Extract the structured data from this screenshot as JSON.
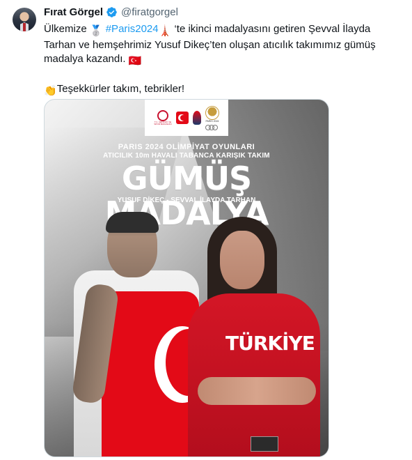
{
  "tweet": {
    "author_name": "Fırat Görgel",
    "handle": "@firatgorgel",
    "text_line1_before_emoji": "Ülkemize ",
    "medal_emoji": "🥈",
    "hashtag": "#Paris2024",
    "tower_emoji": "🗼",
    "text_line1_after": " ‘te ikinci madalyasını getiren Şevval İlayda Tarhan ve hemşehrimiz Yusuf Dikeç’ten oluşan atıcılık takımımız gümüş madalya kazandı. ",
    "flag_emoji": "🇹🇷",
    "clap_emoji": "👏",
    "text_line2": "Teşekkürler takım, tebrikler!"
  },
  "media": {
    "logo_ministry": "T.C. GENÇLİK VE SPOR BAKANLIĞI",
    "logo_paris": "PARIS 2024",
    "subtitle1": "PARIS 2024 OLİMPİYAT OYUNLARI",
    "subtitle2": "ATICILIK 10m HAVALI TABANCA KARIŞIK TAKIM",
    "headline": "GÜMÜŞ MADALYA",
    "athletes": "YUSUF DİKEÇ - ŞEVVAL İLAYDA TARHAN",
    "jersey_text": "TÜRKİYE"
  },
  "colors": {
    "hashtag": "#1d9bf0",
    "verified": "#1d9bf0",
    "turkish_red": "#e30a17"
  }
}
